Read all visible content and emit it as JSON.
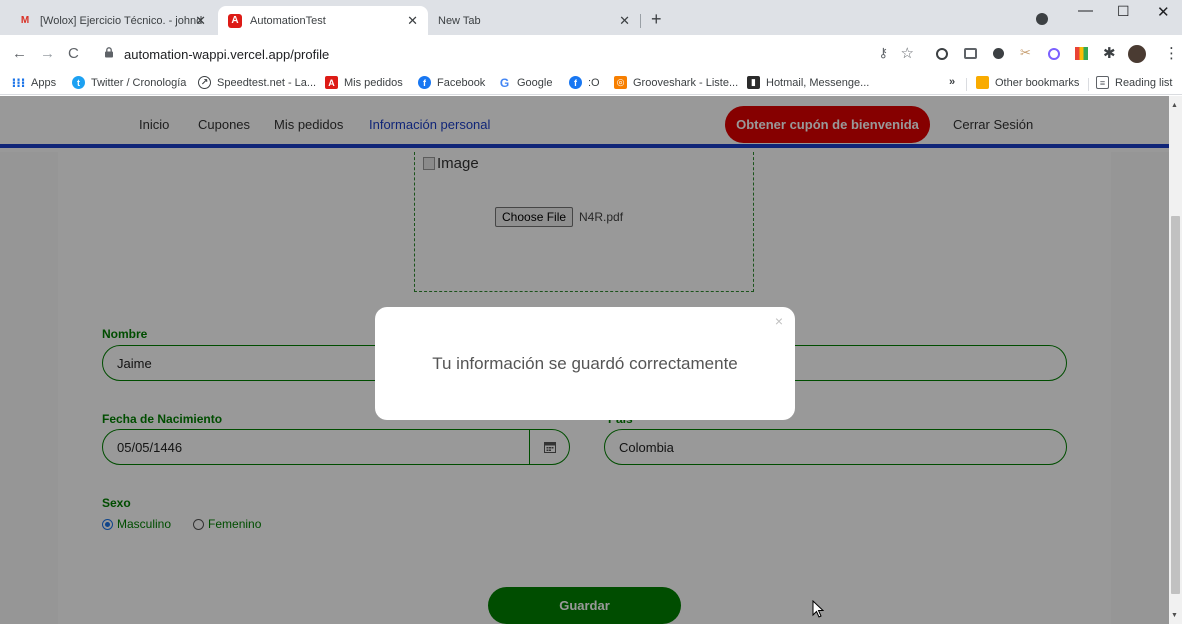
{
  "browser": {
    "tabs": [
      {
        "title": "[Wolox] Ejercicio Técnico. - johnd",
        "favicon": "gmail-icon",
        "active": false
      },
      {
        "title": "AutomationTest",
        "favicon": "angular-icon",
        "active": true
      },
      {
        "title": "New Tab",
        "favicon": "",
        "active": false
      }
    ],
    "url": "automation-wappi.vercel.app/profile",
    "bookmarks": [
      {
        "label": "Apps",
        "icon": "apps-icon"
      },
      {
        "label": "Twitter / Cronología",
        "icon": "twitter-icon"
      },
      {
        "label": "Speedtest.net - La...",
        "icon": "speedtest-icon"
      },
      {
        "label": "Mis pedidos",
        "icon": "angular-icon"
      },
      {
        "label": "Facebook",
        "icon": "facebook-icon"
      },
      {
        "label": "Google",
        "icon": "google-icon"
      },
      {
        "label": ":O",
        "icon": "facebook-icon"
      },
      {
        "label": "Grooveshark - Liste...",
        "icon": "grooveshark-icon"
      },
      {
        "label": "Hotmail, Messenge...",
        "icon": "hotmail-icon"
      }
    ],
    "bookmarks_overflow": "»",
    "other_bookmarks": "Other bookmarks",
    "reading_list": "Reading list"
  },
  "nav": {
    "links": [
      {
        "label": "Inicio",
        "active": false
      },
      {
        "label": "Cupones",
        "active": false
      },
      {
        "label": "Mis pedidos",
        "active": false
      },
      {
        "label": "Información personal",
        "active": true
      }
    ],
    "cta_label": "Obtener cupón de bienvenida",
    "logout_label": "Cerrar Sesión"
  },
  "profile": {
    "image_alt": "Image",
    "file_button": "Choose File",
    "file_name": "N4R.pdf",
    "nombre_label": "Nombre",
    "nombre_value": "Jaime",
    "apellido_value": "",
    "fecha_label": "Fecha de Nacimiento",
    "fecha_value": "05/05/1446",
    "pais_label": "País",
    "pais_value": "Colombia",
    "sexo_label": "Sexo",
    "sexo_options": [
      {
        "label": "Masculino",
        "selected": true
      },
      {
        "label": "Femenino",
        "selected": false
      }
    ],
    "save_label": "Guardar"
  },
  "modal": {
    "message": "Tu información se guardó correctamente",
    "close": "×"
  },
  "colors": {
    "brand_blue": "#1c3fc8",
    "cta_red": "#e00000",
    "field_green": "#008000"
  }
}
